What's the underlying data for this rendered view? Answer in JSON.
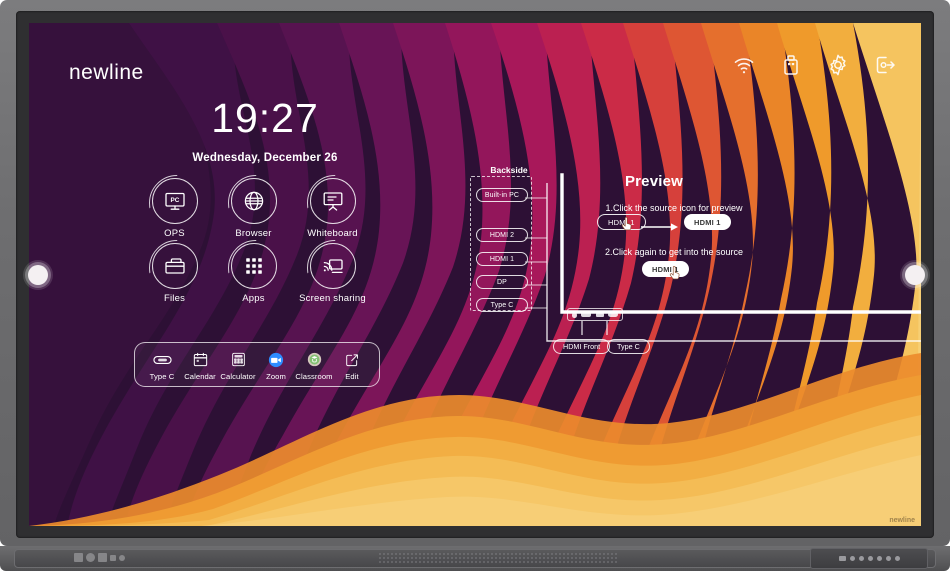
{
  "brand": {
    "logo": "newline",
    "bezel_mark": "newline"
  },
  "topbar": {
    "icons": [
      {
        "name": "wifi-icon",
        "label": "Wi-Fi"
      },
      {
        "name": "usb-drive-icon",
        "label": "USB"
      },
      {
        "name": "settings-gear-icon",
        "label": "Settings"
      },
      {
        "name": "logout-icon",
        "label": "Exit"
      }
    ]
  },
  "clock": {
    "time": "19:27",
    "date": "Wednesday, December 26"
  },
  "apps": [
    {
      "label": "OPS",
      "icon": "ops-pc-icon"
    },
    {
      "label": "Browser",
      "icon": "browser-globe-icon"
    },
    {
      "label": "Whiteboard",
      "icon": "whiteboard-icon"
    },
    {
      "label": "Files",
      "icon": "files-folder-icon"
    },
    {
      "label": "Apps",
      "icon": "apps-grid-icon"
    },
    {
      "label": "Screen sharing",
      "icon": "screen-sharing-icon"
    }
  ],
  "dock": [
    {
      "label": "Type C",
      "icon": "type-c-icon"
    },
    {
      "label": "Calendar",
      "icon": "calendar-icon"
    },
    {
      "label": "Calculator",
      "icon": "calculator-icon"
    },
    {
      "label": "Zoom",
      "icon": "zoom-camera-icon"
    },
    {
      "label": "Classroom",
      "icon": "classroom-icon"
    },
    {
      "label": "Edit",
      "icon": "edit-pencil-icon"
    }
  ],
  "backside": {
    "title": "Backside",
    "sources": [
      {
        "label": "Built-in PC"
      },
      {
        "label": "HDMI 2"
      },
      {
        "label": "HDMI 1"
      },
      {
        "label": "DP"
      },
      {
        "label": "Type C"
      }
    ]
  },
  "preview": {
    "title": "Preview",
    "step1_text": "1.Click the source icon for preview",
    "step1_from": "HDMI 1",
    "step1_to": "HDMI 1",
    "step2_text": "2.Click again to get into the source",
    "step2_pill": "HDMI 1"
  },
  "front": {
    "ports": [
      "power-icon",
      "hdmi-port-icon",
      "usb-port-icon",
      "type-c-port-icon"
    ],
    "pills": [
      {
        "label": "HDMI Front"
      },
      {
        "label": "Type C"
      }
    ]
  },
  "colors": {
    "wave_1": "#2d1035",
    "wave_2": "#3f1145",
    "wave_3": "#521350",
    "wave_4": "#6b1557",
    "wave_5": "#8e1659",
    "wave_6": "#b01b56",
    "wave_7": "#c9234e",
    "wave_8": "#d63a3f",
    "wave_9": "#e05534",
    "wave_10": "#e8762a",
    "wave_11": "#ef9029",
    "wave_12": "#f2a83c",
    "wave_13": "#f5c15b",
    "wave_14": "#f7ce72",
    "accent_white": "#ffffff",
    "bezel": "#6e6e70"
  }
}
